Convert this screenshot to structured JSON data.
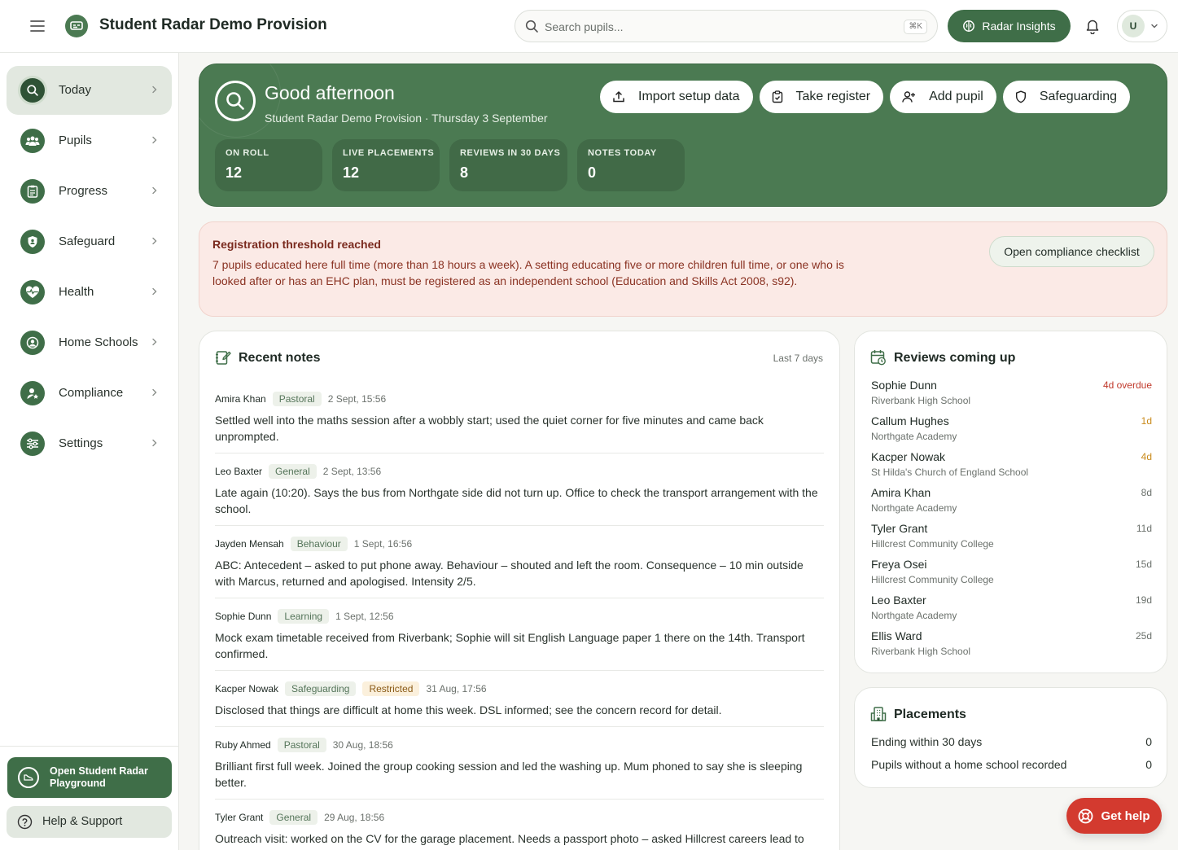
{
  "app": {
    "title": "Student Radar Demo Provision"
  },
  "search": {
    "placeholder": "Search pupils...",
    "shortcut": "⌘K"
  },
  "header": {
    "insights_label": "Radar Insights",
    "user_initial": "U"
  },
  "sidebar": {
    "items": [
      {
        "label": "Today",
        "icon": "search-icon",
        "active": true
      },
      {
        "label": "Pupils",
        "icon": "users-icon"
      },
      {
        "label": "Progress",
        "icon": "clipboard-icon"
      },
      {
        "label": "Safeguard",
        "icon": "shield-icon"
      },
      {
        "label": "Health",
        "icon": "heart-pulse-icon"
      },
      {
        "label": "Home Schools",
        "icon": "user-circle-icon"
      },
      {
        "label": "Compliance",
        "icon": "user-star-icon"
      },
      {
        "label": "Settings",
        "icon": "sliders-icon"
      }
    ],
    "playground_label": "Open Student Radar Playground",
    "help_label": "Help & Support"
  },
  "hero": {
    "greeting": "Good afternoon",
    "subtitle": "Student Radar Demo Provision · Thursday 3 September",
    "actions": [
      {
        "label": "Import setup data",
        "icon": "upload-icon"
      },
      {
        "label": "Take register",
        "icon": "clipboard-check-icon"
      },
      {
        "label": "Add pupil",
        "icon": "user-plus-icon"
      },
      {
        "label": "Safeguarding",
        "icon": "shield-icon"
      }
    ],
    "stats": [
      {
        "label": "ON ROLL",
        "value": "12"
      },
      {
        "label": "LIVE PLACEMENTS",
        "value": "12"
      },
      {
        "label": "REVIEWS IN 30 DAYS",
        "value": "8"
      },
      {
        "label": "NOTES TODAY",
        "value": "0"
      }
    ]
  },
  "alert": {
    "title": "Registration threshold reached",
    "body": "7 pupils educated here full time (more than 18 hours a week). A setting educating five or more children full time, or one who is looked after or has an EHC plan, must be registered as an independent school (Education and Skills Act 2008, s92).",
    "button_label": "Open compliance checklist"
  },
  "notes": {
    "title": "Recent notes",
    "range": "Last 7 days",
    "items": [
      {
        "name": "Amira Khan",
        "tag": "Pastoral",
        "time": "2 Sept, 15:56",
        "text": "Settled well into the maths session after a wobbly start; used the quiet corner for five minutes and came back unprompted."
      },
      {
        "name": "Leo Baxter",
        "tag": "General",
        "time": "2 Sept, 13:56",
        "text": "Late again (10:20). Says the bus from Northgate side did not turn up. Office to check the transport arrangement with the school."
      },
      {
        "name": "Jayden Mensah",
        "tag": "Behaviour",
        "time": "1 Sept, 16:56",
        "text": "ABC: Antecedent – asked to put phone away. Behaviour – shouted and left the room. Consequence – 10 min outside with Marcus, returned and apologised. Intensity 2/5."
      },
      {
        "name": "Sophie Dunn",
        "tag": "Learning",
        "time": "1 Sept, 12:56",
        "text": "Mock exam timetable received from Riverbank; Sophie will sit English Language paper 1 there on the 14th. Transport confirmed."
      },
      {
        "name": "Kacper Nowak",
        "tag": "Safeguarding",
        "tag2": "Restricted",
        "time": "31 Aug, 17:56",
        "text": "Disclosed that things are difficult at home this week. DSL informed; see the concern record for detail."
      },
      {
        "name": "Ruby Ahmed",
        "tag": "Pastoral",
        "time": "30 Aug, 18:56",
        "text": "Brilliant first full week. Joined the group cooking session and led the washing up. Mum phoned to say she is sleeping better."
      },
      {
        "name": "Tyler Grant",
        "tag": "General",
        "time": "29 Aug, 18:56",
        "text": "Outreach visit: worked on the CV for the garage placement. Needs a passport photo – asked Hillcrest careers lead to help."
      }
    ]
  },
  "reviews": {
    "title": "Reviews coming up",
    "items": [
      {
        "name": "Sophie Dunn",
        "school": "Riverbank High School",
        "due": "4d overdue",
        "color": "#c0392b"
      },
      {
        "name": "Callum Hughes",
        "school": "Northgate Academy",
        "due": "1d",
        "color": "#c98a1a"
      },
      {
        "name": "Kacper Nowak",
        "school": "St Hilda's Church of England School",
        "due": "4d",
        "color": "#c98a1a"
      },
      {
        "name": "Amira Khan",
        "school": "Northgate Academy",
        "due": "8d",
        "color": "#6b716c"
      },
      {
        "name": "Tyler Grant",
        "school": "Hillcrest Community College",
        "due": "11d",
        "color": "#6b716c"
      },
      {
        "name": "Freya Osei",
        "school": "Hillcrest Community College",
        "due": "15d",
        "color": "#6b716c"
      },
      {
        "name": "Leo Baxter",
        "school": "Northgate Academy",
        "due": "19d",
        "color": "#6b716c"
      },
      {
        "name": "Ellis Ward",
        "school": "Riverbank High School",
        "due": "25d",
        "color": "#6b716c"
      }
    ]
  },
  "placements": {
    "title": "Placements",
    "rows": [
      {
        "label": "Ending within 30 days",
        "value": "0"
      },
      {
        "label": "Pupils without a home school recorded",
        "value": "0"
      }
    ]
  },
  "get_help": {
    "label": "Get help"
  },
  "colors": {
    "brand": "#4b7a52",
    "brand_dark": "#3f6e48",
    "alert_bg": "#fbeae6",
    "help_red": "#d33a2f"
  }
}
